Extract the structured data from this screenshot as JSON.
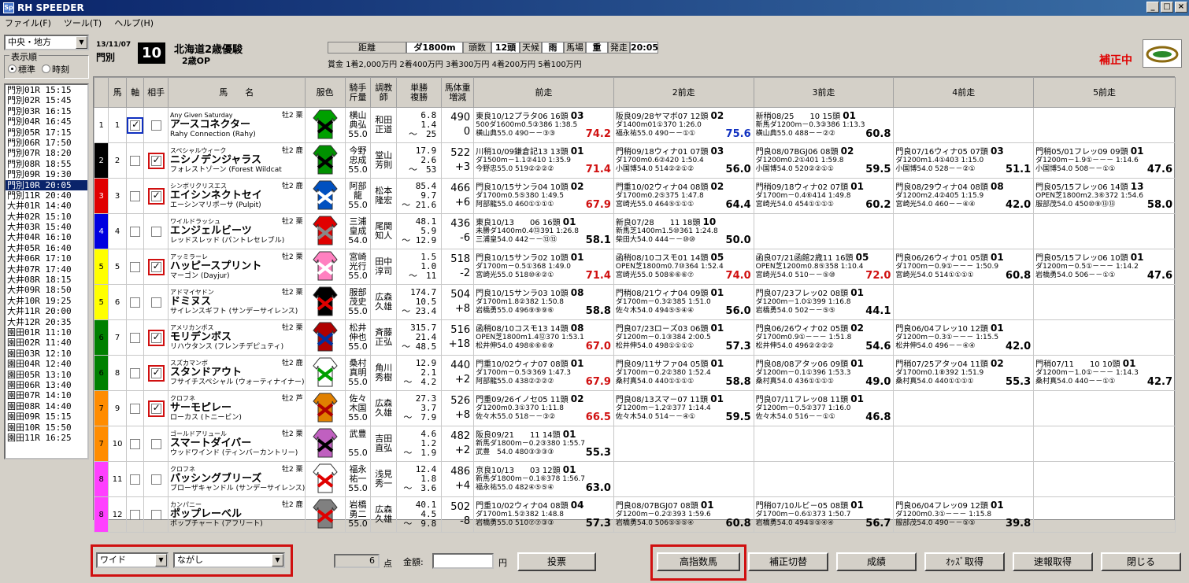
{
  "window": {
    "title": "RH SPEEDER",
    "icon": "Sp",
    "controls": [
      "_",
      "□",
      "×"
    ]
  },
  "menu": [
    "ファイル(F)",
    "ツール(T)",
    "ヘルプ(H)"
  ],
  "sidebar": {
    "region": "中央・地方",
    "order_label": "表示順",
    "order_opts": [
      "標準",
      "時刻"
    ],
    "races": [
      "門別01R 15:15",
      "門別02R 15:45",
      "門別03R 16:15",
      "門別04R 16:45",
      "門別05R 17:15",
      "門別06R 17:50",
      "門別07R 18:20",
      "門別08R 18:55",
      "門別09R 19:30",
      "門別10R 20:05",
      "門別11R 20:40",
      "大井01R 14:40",
      "大井02R 15:10",
      "大井03R 15:40",
      "大井04R 16:10",
      "大井05R 16:40",
      "大井06R 17:10",
      "大井07R 17:40",
      "大井08R 18:15",
      "大井09R 18:50",
      "大井10R 19:25",
      "大井11R 20:00",
      "大井12R 20:35",
      "園田01R 11:10",
      "園田02R 11:40",
      "園田03R 12:10",
      "園田04R 12:40",
      "園田05R 13:10",
      "園田06R 13:40",
      "園田07R 14:10",
      "園田08R 14:40",
      "園田09R 15:15",
      "園田10R 15:50",
      "園田11R 16:25"
    ],
    "selected": 9
  },
  "race": {
    "date": "13/11/07",
    "course": "門別",
    "num": "10",
    "name": "北海道2歳優駿",
    "class": "2歳OP",
    "info": [
      [
        "距離",
        ""
      ],
      [
        "ダ1800m",
        ""
      ],
      [
        "頭数",
        ""
      ],
      [
        "12頭",
        ""
      ],
      [
        "天候",
        ""
      ],
      [
        "雨",
        ""
      ],
      [
        "馬場",
        ""
      ],
      [
        "重",
        ""
      ],
      [
        "発走",
        ""
      ],
      [
        "20:05",
        ""
      ]
    ],
    "prize": "賞金 1着2,000万円  2着400万円  3着300万円  4着200万円  5着100万円",
    "status": "補正中"
  },
  "columns": [
    "馬",
    "軸",
    "相手",
    "馬　　名",
    "服色",
    "騎手\n斤量",
    "調教\n師",
    "単勝\n複勝",
    "馬体重\n増減",
    "前走",
    "2前走",
    "3前走",
    "4前走",
    "5前走"
  ],
  "horses": [
    {
      "waku": "1",
      "num": "1",
      "axis": true,
      "pair": false,
      "sire": "Any Given Saturday",
      "sex": "牡2 栗",
      "name": "アースコネクター",
      "dam": "Rahy Connection (Rahy)",
      "jockey": "横山\n典弘\n55.0",
      "trainer": "和田\n正道",
      "odds": "6.8\n1.4\n～　25",
      "weight": "490",
      "diff": "0",
      "prev": [
        [
          "東良10/12プラタ06 16頭",
          "03",
          "500ダ1600m0.5③386 1:38.5",
          "横山典55.0 490－－③③",
          "74.2",
          "red"
        ],
        [
          "阪良09/28ヤマボ07 12頭",
          "02",
          "ダ1400m01①370 1:26.0",
          "福永祐55.0 490－－①①",
          "75.6",
          "blue"
        ],
        [
          "新稍08/25　　10 15頭",
          "01",
          "新馬ダ1200m－0.3③386 1:13.3",
          "横山典55.0 488－－②②",
          "60.8",
          ""
        ],
        [
          "",
          "",
          "",
          "",
          "",
          ""
        ],
        [
          "",
          "",
          "",
          "",
          "",
          ""
        ]
      ]
    },
    {
      "waku": "2",
      "num": "2",
      "axis": false,
      "pair": true,
      "sire": "スペシャルウィーク",
      "sex": "牡2 鹿",
      "name": "ニシノデンジャラス",
      "dam": "フォレストゾーン (Forest Wildcat",
      "jockey": "今野\n忠成\n55.0",
      "trainer": "堂山\n芳則",
      "odds": "17.9\n2.6\n～　53",
      "weight": "522",
      "diff": "+3",
      "prev": [
        [
          "川稍10/09鎌倉記13 13頭",
          "01",
          "ダ1500m－1.1②410 1:35.9",
          "今野忠55.0 519②②②②",
          "71.4",
          "red"
        ],
        [
          "門稍09/18ウィナ01 07頭",
          "03",
          "ダ1700m0.6②420 1:50.4",
          "小国博54.0 514②②①②",
          "56.0",
          ""
        ],
        [
          "門良08/07BGJ06 08頭",
          "02",
          "ダ1200m0.2①401 1:59.8",
          "小国博54.0 520②②①①",
          "59.5",
          ""
        ],
        [
          "門良07/16ウィナ05 07頭",
          "03",
          "ダ1200m1.4①403 1:15.0",
          "小国博54.0 528－－②①",
          "51.1",
          ""
        ],
        [
          "門稍05/01フレッ09 09頭",
          "01",
          "ダ1200m－1.9①－－－ 1:14.6",
          "小国博54.0 508－－①①",
          "47.6",
          ""
        ]
      ]
    },
    {
      "waku": "3",
      "num": "3",
      "axis": false,
      "pair": true,
      "sire": "シンボリクリスエス",
      "sex": "牡2 鹿",
      "name": "エイシンネクトセイ",
      "dam": "エーシンマリポーサ (Pulpit)",
      "jockey": "阿部\n龍\n55.0",
      "trainer": "松本\n隆宏",
      "odds": "85.4\n9.7\n～ 21.6",
      "weight": "466",
      "diff": "+6",
      "prev": [
        [
          "門良10/15サンラ04 10頭",
          "02",
          "ダ1700m0.5⑤380 1:49.5",
          "阿部龍55.0 460①①①①",
          "67.9",
          "red"
        ],
        [
          "門重10/02ウィナ04 08頭",
          "02",
          "ダ1700m0.2⑤375 1:47.8",
          "宮崎光55.0 464⑤①①①",
          "64.4",
          ""
        ],
        [
          "門稍09/18ウィナ02 07頭",
          "01",
          "ダ1700m－0.4⑥414 1:49.8",
          "宮崎光54.0 454①①①①",
          "60.2",
          ""
        ],
        [
          "門良08/29ウィナ04 08頭",
          "08",
          "ダ1200m2.4②405 1:15.9",
          "宮崎光54.0 460－－④④",
          "42.0",
          ""
        ],
        [
          "門良05/15フレッ06 14頭",
          "13",
          "OPEN芝1800m2.3⑥372 1:54.6",
          "服部茂54.0 450⑩⑨⑬⑬",
          "58.0",
          ""
        ]
      ]
    },
    {
      "waku": "4",
      "num": "4",
      "axis": false,
      "pair": false,
      "sire": "ワイルドラッシュ",
      "sex": "牡2 栗",
      "name": "エンジェルビーツ",
      "dam": "レッドスレッド (パントレセレブル)",
      "jockey": "三浦\n皇成\n54.0",
      "trainer": "尾関\n知人",
      "odds": "48.1\n5.9\n～ 12.9",
      "weight": "436",
      "diff": "-6",
      "prev": [
        [
          "東良10/13　　06 16頭",
          "01",
          "未勝ダ1400m0.4⑬391 1:26.8",
          "三浦皇54.0 442－－⑬⑬",
          "58.1",
          ""
        ],
        [
          "新良07/28　　11 18頭",
          "10",
          "新馬芝1400m1.5⑩361 1:24.8",
          "柴田大54.0 444－－⑩⑩",
          "50.0",
          ""
        ],
        [
          "",
          "",
          "",
          "",
          "",
          ""
        ],
        [
          "",
          "",
          "",
          "",
          "",
          ""
        ],
        [
          "",
          "",
          "",
          "",
          "",
          ""
        ]
      ]
    },
    {
      "waku": "5",
      "num": "5",
      "axis": false,
      "pair": true,
      "sire": "アッミラーレ",
      "sex": "牡2 栗",
      "name": "ハッピースプリント",
      "dam": "マーゴン (Dayjur)",
      "jockey": "宮崎\n光行\n55.0",
      "trainer": "田中\n淳司",
      "odds": "1.5\n1.0\n～　11",
      "weight": "518",
      "diff": "-2",
      "prev": [
        [
          "門良10/15サンラ02 10頭",
          "01",
          "ダ1700m－0.5①368 1:49.0",
          "宮崎光55.0 518⑩④②①",
          "71.4",
          "red"
        ],
        [
          "函稍08/10コスモ01 14頭",
          "05",
          "OPEN芝1800m0.7⑩364 1:52.4",
          "宮崎光55.0 508⑥⑥⑥⑦",
          "74.0",
          "red"
        ],
        [
          "函良07/21函館2歳11 16頭",
          "05",
          "OPEN芝1200m0.8⑤358 1:10.4",
          "宮崎光54.0 510－－⑤⑩",
          "72.0",
          "red"
        ],
        [
          "門良06/26ウィナ01 05頭",
          "01",
          "ダ1700m－0.9①－－－ 1:50.9",
          "宮崎光54.0 514①①①①",
          "60.8",
          ""
        ],
        [
          "門良05/15フレッ06 10頭",
          "01",
          "ダ1200m－0.5①－－－ 1:14.2",
          "岩橋勇54.0 506－－①①",
          "47.6",
          ""
        ]
      ]
    },
    {
      "waku": "5",
      "num": "6",
      "axis": false,
      "pair": false,
      "sire": "アドマイヤドン",
      "sex": "牡2 栗",
      "name": "ドミヌス",
      "dam": "サイレンスギフト (サンデーサイレンス)",
      "jockey": "服部\n茂史\n55.0",
      "trainer": "広森\n久雄",
      "odds": "174.7\n10.5\n～ 23.4",
      "weight": "504",
      "diff": "+8",
      "prev": [
        [
          "門良10/15サンラ03 10頭",
          "08",
          "ダ1700m1.8②382 1:50.8",
          "岩橋勇55.0 496⑨⑨⑨⑥",
          "58.8",
          ""
        ],
        [
          "門稍08/21ウィナ04 09頭",
          "01",
          "ダ1700m－0.3②385 1:51.0",
          "佐々木54.0 494⑤⑤④④",
          "56.0",
          ""
        ],
        [
          "門良07/23フレッ02 08頭",
          "01",
          "ダ1200m－1.0①399 1:16.8",
          "岩橋勇54.0 502－－⑤⑤",
          "44.1",
          ""
        ],
        [
          "",
          "",
          "",
          "",
          "",
          ""
        ],
        [
          "",
          "",
          "",
          "",
          "",
          ""
        ]
      ]
    },
    {
      "waku": "6",
      "num": "7",
      "axis": false,
      "pair": true,
      "sire": "アメリカンボス",
      "sex": "牡2 栗",
      "name": "モリデンボス",
      "dam": "リハウタンス (フレンチデピュティ)",
      "jockey": "松井\n伸也\n55.0",
      "trainer": "斉藤\n正弘",
      "odds": "315.7\n21.4\n～ 48.5",
      "weight": "516",
      "diff": "+18",
      "prev": [
        [
          "函稍08/10コスモ13 14頭",
          "08",
          "OPEN芝1800m1.4⑫370 1:53.1",
          "松井伸54.0 498⑥⑥⑥⑨",
          "67.0",
          "red"
        ],
        [
          "門良07/23ロ－ズ03 06頭",
          "01",
          "ダ1200m－0.1③384 2:00.5",
          "松井伸54.0 498①①①①",
          "57.3",
          ""
        ],
        [
          "門良06/26ウィナ02 05頭",
          "02",
          "ダ1700m0.9①－－－ 1:51.8",
          "松井伸54.0 496②②②②",
          "54.6",
          ""
        ],
        [
          "門良06/04フレッ10 12頭",
          "01",
          "ダ1200m－0.3①－－－ 1:15.5",
          "松井伸54.0 496－－④④",
          "42.0",
          ""
        ],
        [
          "",
          "",
          "",
          "",
          "",
          ""
        ]
      ]
    },
    {
      "waku": "6",
      "num": "8",
      "axis": false,
      "pair": true,
      "sire": "スズカマンボ",
      "sex": "牡2 鹿",
      "name": "スタンドアウト",
      "dam": "フサイチスペシャル (ウォーティナイナー)",
      "jockey": "桑村\n真明\n55.0",
      "trainer": "角川\n秀樹",
      "odds": "12.9\n2.1\n～　4.2",
      "weight": "440",
      "diff": "+2",
      "prev": [
        [
          "門重10/02ウィナ07 08頭",
          "01",
          "ダ1700m－0.5③369 1:47.3",
          "阿部龍55.0 438②②②②",
          "67.9",
          "red"
        ],
        [
          "門良09/11サファ04 05頭",
          "01",
          "ダ1700m－0.2②380 1:52.4",
          "桑村真54.0 440①①①①",
          "58.8",
          ""
        ],
        [
          "門良08/08アタッ06 09頭",
          "01",
          "ダ1200m－0.1①396 1:53.3",
          "桑村真54.0 436①①①①",
          "49.0",
          ""
        ],
        [
          "門稍07/25アタッ04 11頭",
          "02",
          "ダ1700m0.1⑧392 1:51.9",
          "桑村真54.0 440①①①①",
          "55.3",
          ""
        ],
        [
          "門稍07/11　　10 10頭",
          "01",
          "ダ1200m－1.0①－－－ 1:14.3",
          "桑村真54.0 440－－①①",
          "42.7",
          ""
        ]
      ]
    },
    {
      "waku": "7",
      "num": "9",
      "axis": false,
      "pair": true,
      "sire": "クロフネ",
      "sex": "牡2 芦",
      "name": "サーモピレー",
      "dam": "ローカス (トニービン)",
      "jockey": "佐々\n木国\n55.0",
      "trainer": "広森\n久雄",
      "odds": "27.3\n3.7\n～　7.9",
      "weight": "526",
      "diff": "+8",
      "prev": [
        [
          "門重09/26イノセ05 11頭",
          "02",
          "ダ1200m0.3①370 1:11.8",
          "佐々木55.0 518－－③②",
          "66.5",
          "red"
        ],
        [
          "門良08/13スマ－07 11頭",
          "01",
          "ダ1200m－1.2②377 1:14.4",
          "佐々木54.0 514－－④①",
          "59.5",
          ""
        ],
        [
          "門良07/11フレッ08 11頭",
          "01",
          "ダ1200m－0.5②377 1:16.0",
          "佐々木54.0 516－－①①",
          "46.8",
          ""
        ],
        [
          "",
          "",
          "",
          "",
          "",
          ""
        ],
        [
          "",
          "",
          "",
          "",
          "",
          ""
        ]
      ]
    },
    {
      "waku": "7",
      "num": "10",
      "axis": false,
      "pair": false,
      "sire": "ゴールドアリュール",
      "sex": "牡2 栗",
      "name": "スマートダイバー",
      "dam": "ウッドワインド (ティンバーカントリー)",
      "jockey": "武豊\n\n55.0",
      "trainer": "吉田\n直弘",
      "odds": "4.6\n1.2\n～　1.9",
      "weight": "482",
      "diff": "+2",
      "prev": [
        [
          "阪良09/21　　11 14頭",
          "01",
          "新馬ダ1800m－0.2③380 1:55.7",
          "武豊　54.0 480③③③③",
          "55.3",
          ""
        ],
        [
          "",
          "",
          "",
          "",
          "",
          ""
        ],
        [
          "",
          "",
          "",
          "",
          "",
          ""
        ],
        [
          "",
          "",
          "",
          "",
          "",
          ""
        ],
        [
          "",
          "",
          "",
          "",
          "",
          ""
        ]
      ]
    },
    {
      "waku": "8",
      "num": "11",
      "axis": false,
      "pair": false,
      "sire": "クロフネ",
      "sex": "牡2 栗",
      "name": "パッシングブリーズ",
      "dam": "ブローザキャンドル (サンデーサイレンス)",
      "jockey": "福永\n祐一\n55.0",
      "trainer": "浅見\n秀一",
      "odds": "12.4\n1.8\n～　3.6",
      "weight": "486",
      "diff": "+4",
      "prev": [
        [
          "京良10/13　　03 12頭",
          "01",
          "新馬ダ1800m－0.1⑥378 1:56.7",
          "福永祐55.0 482④⑤⑤④",
          "63.0",
          ""
        ],
        [
          "",
          "",
          "",
          "",
          "",
          ""
        ],
        [
          "",
          "",
          "",
          "",
          "",
          ""
        ],
        [
          "",
          "",
          "",
          "",
          "",
          ""
        ],
        [
          "",
          "",
          "",
          "",
          "",
          ""
        ]
      ]
    },
    {
      "waku": "8",
      "num": "12",
      "axis": false,
      "pair": false,
      "sire": "カンパニー",
      "sex": "牡2 鹿",
      "name": "ポップレーベル",
      "dam": "ポップチャート (アフリート)",
      "jockey": "岩橋\n勇二\n55.0",
      "trainer": "広森\n久雄",
      "odds": "40.1\n4.5\n～　9.8",
      "weight": "502",
      "diff": "-8",
      "prev": [
        [
          "門重10/02ウィナ04 08頭",
          "04",
          "ダ1700m1.5②382 1:48.8",
          "岩橋勇55.0 510⑦⑦③③",
          "57.3",
          ""
        ],
        [
          "門良08/07BGJ07 08頭",
          "01",
          "ダ1200m－0.2②393 1:59.6",
          "岩橋勇54.0 506⑤⑤⑤④",
          "60.8",
          ""
        ],
        [
          "門稍07/10ルビ－05 08頭",
          "01",
          "ダ1700m－0.6①373 1:50.7",
          "岩橋勇54.0 494⑤⑤④④",
          "56.7",
          ""
        ],
        [
          "門良06/04フレッ09 12頭",
          "01",
          "ダ1200m0.3①－－－ 1:15.8",
          "服部茂54.0 490－－⑤⑤",
          "39.8",
          ""
        ],
        [
          "",
          "",
          "",
          "",
          "",
          ""
        ]
      ]
    }
  ],
  "waku_colors": {
    "1": "#ffffff",
    "2": "#000000",
    "3": "#e00000",
    "4": "#0000e0",
    "5": "#ffff00",
    "6": "#008000",
    "7": "#ff8c00",
    "8": "#ff40ff"
  },
  "bottom": {
    "bet_type": "ワイド",
    "bet_style": "ながし",
    "points": "6",
    "points_unit": "点",
    "amount_label": "金額:",
    "amount": "",
    "yen": "円",
    "buttons": [
      "投票",
      "高指数馬",
      "補正切替",
      "成績",
      "ｵｯｽﾞ取得",
      "速報取得",
      "閉じる"
    ]
  }
}
